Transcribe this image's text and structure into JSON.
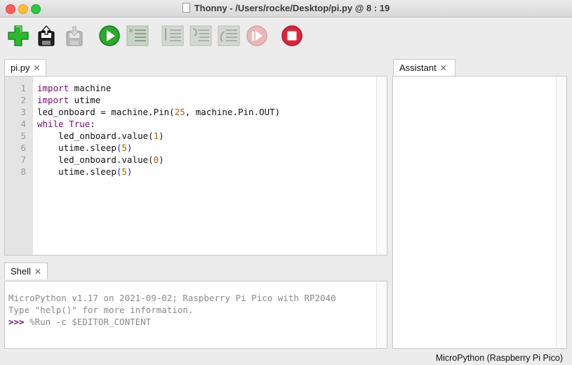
{
  "window": {
    "title": "Thonny  -  /Users/rocke/Desktop/pi.py  @  8 : 19"
  },
  "toolbar": {
    "buttons": [
      {
        "name": "new-file",
        "color": "#2db82d"
      },
      {
        "name": "open-file"
      },
      {
        "name": "save-file"
      },
      {
        "name": "run",
        "color": "#2ca82c"
      },
      {
        "name": "debug"
      },
      {
        "name": "step-over"
      },
      {
        "name": "step-into"
      },
      {
        "name": "step-out"
      },
      {
        "name": "resume"
      },
      {
        "name": "stop",
        "color": "#e0243c"
      }
    ]
  },
  "editor": {
    "tab_label": "pi.py",
    "line_numbers": [
      "1",
      "2",
      "3",
      "4",
      "5",
      "6",
      "7",
      "8"
    ],
    "lines": [
      "import machine",
      "import utime",
      "led_onboard = machine.Pin(25, machine.Pin.OUT)",
      "while True:",
      "    led_onboard.value(1)",
      "    utime.sleep(5)",
      "    led_onboard.value(0)",
      "    utime.sleep(5)"
    ]
  },
  "shell": {
    "tab_label": "Shell",
    "banner_line1": "MicroPython v1.17 on 2021-09-02; Raspberry Pi Pico with RP2040",
    "banner_line2": "Type \"help()\" for more information.",
    "prompt": ">>>",
    "command": " %Run -c $EDITOR_CONTENT"
  },
  "assistant": {
    "tab_label": "Assistant"
  },
  "status_bar": {
    "interpreter": "MicroPython (Raspberry Pi Pico)"
  }
}
